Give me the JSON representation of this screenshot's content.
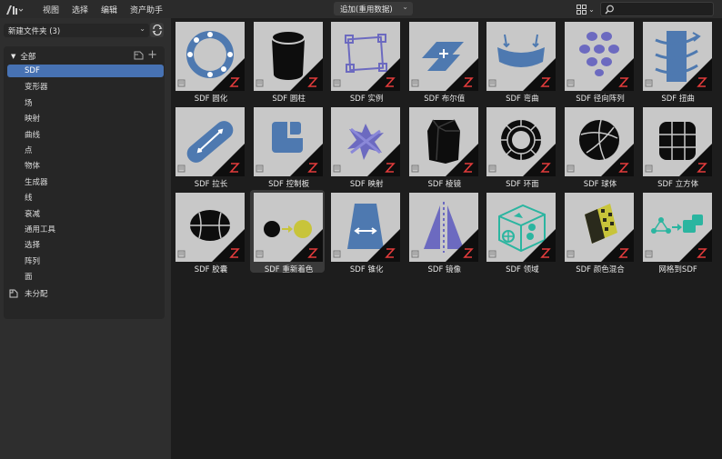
{
  "header": {
    "menus": [
      "视图",
      "选择",
      "编辑",
      "资产助手"
    ],
    "library": "追加(重用数据)"
  },
  "sidebar": {
    "folder": "新建文件夹 (3)",
    "root": "全部",
    "categories": [
      "SDF",
      "变形器",
      "场",
      "映射",
      "曲线",
      "点",
      "物体",
      "生成器",
      "线",
      "衰减",
      "通用工具",
      "选择",
      "阵列",
      "面"
    ],
    "active_index": 0,
    "unassigned": "未分配"
  },
  "assets": [
    {
      "label": "SDF 圆化",
      "icon": "ring-icon"
    },
    {
      "label": "SDF 圆柱",
      "icon": "cylinder-icon"
    },
    {
      "label": "SDF 实例",
      "icon": "instance-icon"
    },
    {
      "label": "SDF 布尔值",
      "icon": "boolean-icon"
    },
    {
      "label": "SDF 弯曲",
      "icon": "bend-icon"
    },
    {
      "label": "SDF 径向阵列",
      "icon": "radial-array-icon"
    },
    {
      "label": "SDF 扭曲",
      "icon": "twist-icon"
    },
    {
      "label": "SDF 拉长",
      "icon": "elongate-icon"
    },
    {
      "label": "SDF 控制板",
      "icon": "panel-icon"
    },
    {
      "label": "SDF 映射",
      "icon": "map-icon"
    },
    {
      "label": "SDF 棱镜",
      "icon": "prism-icon"
    },
    {
      "label": "SDF 环面",
      "icon": "torus-icon"
    },
    {
      "label": "SDF 球体",
      "icon": "sphere-icon"
    },
    {
      "label": "SDF 立方体",
      "icon": "cube-icon"
    },
    {
      "label": "SDF 胶囊",
      "icon": "capsule-icon"
    },
    {
      "label": "SDF 重新着色",
      "icon": "recolor-icon"
    },
    {
      "label": "SDF 锥化",
      "icon": "taper-icon"
    },
    {
      "label": "SDF 镜像",
      "icon": "mirror-icon"
    },
    {
      "label": "SDF 领域",
      "icon": "domain-icon"
    },
    {
      "label": "SDF 颜色混合",
      "icon": "color-mix-icon"
    },
    {
      "label": "网格到SDF",
      "icon": "mesh-to-sdf-icon"
    }
  ],
  "hover_index": 15,
  "colors": {
    "accent": "#4772b3",
    "thumb_bg": "#c8c8c8",
    "icon_blue": "#4e79b0",
    "icon_purple": "#6c6ac0",
    "badge": "#e23b3b"
  }
}
